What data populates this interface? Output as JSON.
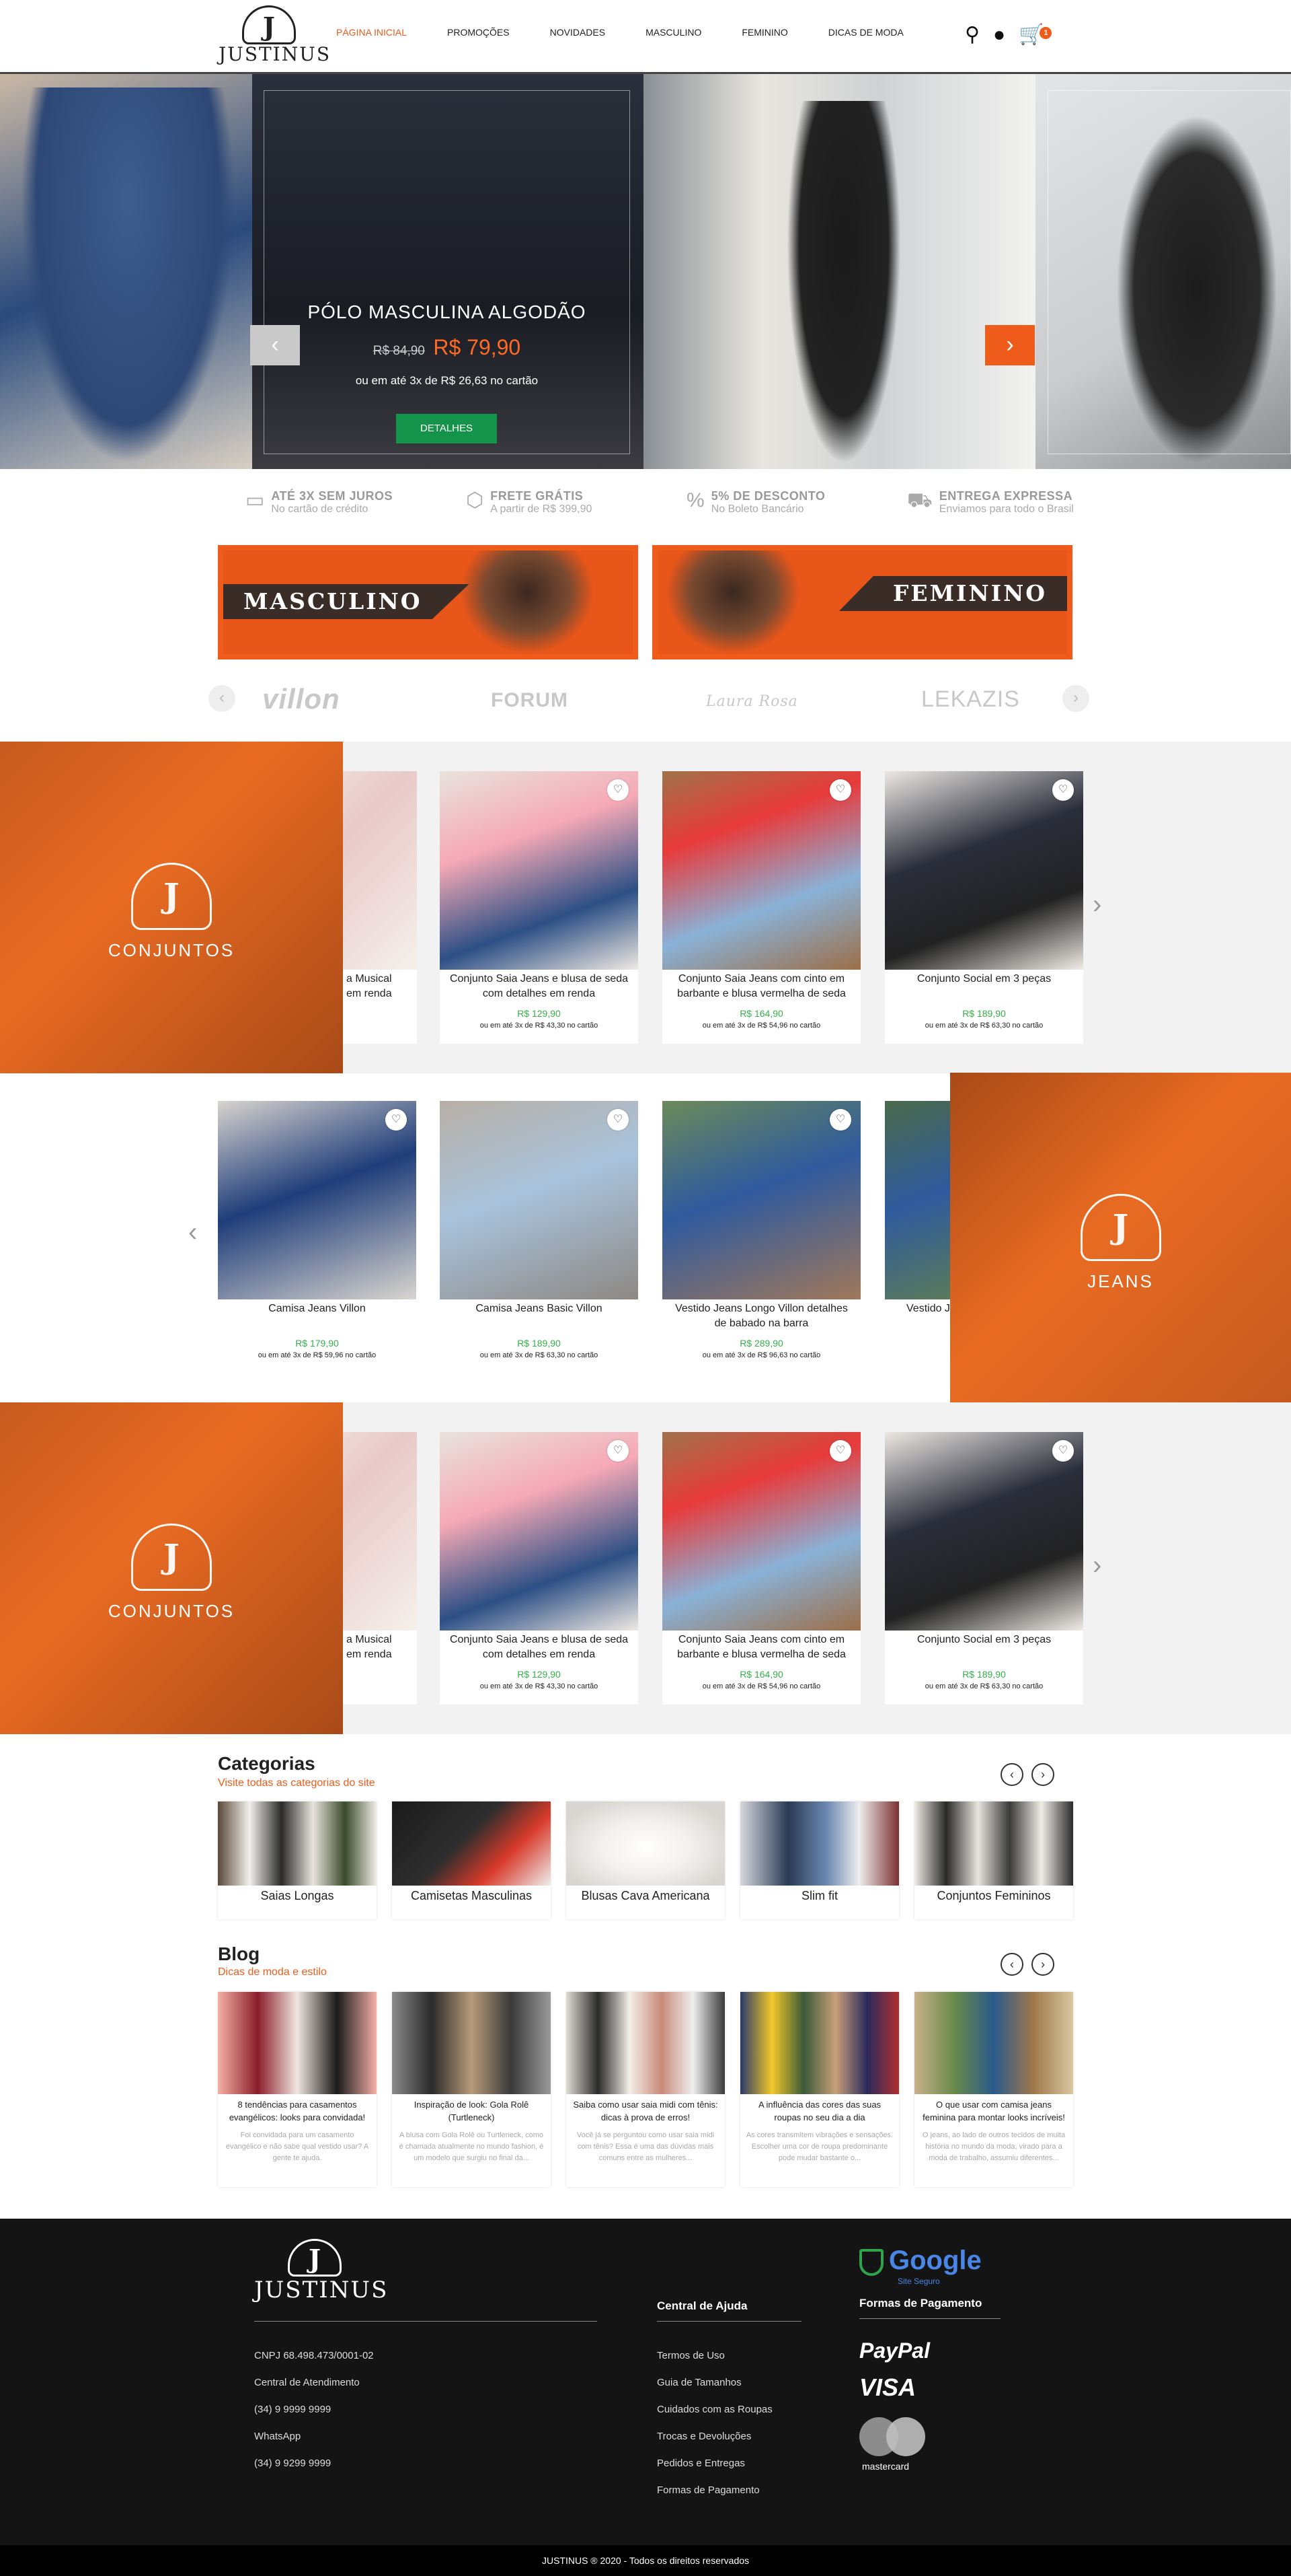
{
  "header": {
    "logo": "JUSTINUS",
    "nav": [
      "PÁGINA INICIAL",
      "PROMOÇÕES",
      "NOVIDADES",
      "MASCULINO",
      "FEMININO",
      "DICAS DE MODA"
    ],
    "cart_count": "1"
  },
  "hero": {
    "title": "PÓLO MASCULINA ALGODÃO",
    "old_price": "R$ 84,90",
    "new_price": "R$ 79,90",
    "installments": "ou em até 3x de R$ 26,63 no cartão",
    "button": "DETALHES",
    "prev": "‹",
    "next": "›"
  },
  "benefits": [
    {
      "icon": "credit-card-icon",
      "title": "ATÉ 3X SEM JUROS",
      "sub": "No cartão de crédito"
    },
    {
      "icon": "box-icon",
      "title": "FRETE GRÁTIS",
      "sub": "A partir de R$ 399,90"
    },
    {
      "icon": "percent-icon",
      "title": "5% DE DESCONTO",
      "sub": "No Boleto Bancário"
    },
    {
      "icon": "truck-icon",
      "title": "ENTREGA EXPRESSA",
      "sub": "Enviamos para todo o Brasil"
    }
  ],
  "category_banners": [
    "MASCULINO",
    "FEMININO"
  ],
  "brands": [
    "villon",
    "FORUM",
    "Laura Rosa",
    "LEKAZIS"
  ],
  "section1": {
    "label": "CONJUNTOS",
    "products": [
      {
        "name": "Conjunto Saia Jeans e blusa de seda com detalhes em renda",
        "price": "R$ 129,90",
        "inst": "ou em até 3x de R$ 43,30 no cartão"
      },
      {
        "name": "Conjunto Saia Jeans com cinto em barbante e blusa vermelha de seda",
        "price": "R$ 164,90",
        "inst": "ou em até 3x de R$ 54,96 no cartão"
      },
      {
        "name": "Conjunto Social em 3 peças",
        "price": "R$ 189,90",
        "inst": "ou em até 3x de R$ 63,30 no cartão"
      }
    ],
    "partial_name": "a Musical\nem renda"
  },
  "section2": {
    "label": "JEANS",
    "products": [
      {
        "name": "Camisa Jeans Villon",
        "price": "R$ 179,90",
        "inst": "ou em até 3x de R$ 59,96 no cartão"
      },
      {
        "name": "Camisa Jeans Basic Villon",
        "price": "R$ 189,90",
        "inst": "ou em até 3x de R$ 63,30 no cartão"
      },
      {
        "name": "Vestido Jeans Longo Villon detalhes de babado na barra",
        "price": "R$ 289,90",
        "inst": "ou em até 3x de R$ 96,63 no cartão"
      }
    ],
    "partial_name": "Vestido Je"
  },
  "section3": {
    "label": "CONJUNTOS",
    "products": [
      {
        "name": "Conjunto Saia Jeans e blusa de seda com detalhes em renda",
        "price": "R$ 129,90",
        "inst": "ou em até 3x de R$ 43,30 no cartão"
      },
      {
        "name": "Conjunto Saia Jeans com cinto em barbante e blusa vermelha de seda",
        "price": "R$ 164,90",
        "inst": "ou em até 3x de R$ 54,96 no cartão"
      },
      {
        "name": "Conjunto Social em 3 peças",
        "price": "R$ 189,90",
        "inst": "ou em até 3x de R$ 63,30 no cartão"
      }
    ],
    "partial_name": "a Musical\nem renda"
  },
  "categorias": {
    "title": "Categorias",
    "subtitle": "Visite todas as categorias do site",
    "items": [
      "Saias Longas",
      "Camisetas Masculinas",
      "Blusas Cava Americana",
      "Slim fit",
      "Conjuntos Femininos"
    ]
  },
  "blog": {
    "title": "Blog",
    "subtitle": "Dicas de moda e estilo",
    "posts": [
      {
        "title": "8 tendências para casamentos evangélicos: looks para convidada!",
        "excerpt": "Foi convidada para um casamento evangélico e não sabe qual vestido usar? A gente te ajuda."
      },
      {
        "title": "Inspiração de look: Gola Rolê (Turtleneck)",
        "excerpt": "A blusa com Gola Rolê ou Turtleneck, como é chamada atualmente no mundo fashion, é um modelo que surgiu no final da..."
      },
      {
        "title": "Saiba como usar saia midi com tênis: dicas à prova de erros!",
        "excerpt": "Você já se perguntou como usar saia midi com tênis? Essa é uma das dúvidas mais comuns entre as mulheres..."
      },
      {
        "title": "A influência das cores das suas roupas no seu dia a dia",
        "excerpt": "As cores transmitem vibrações e sensações. Escolher uma cor de roupa predominante pode mudar bastante o..."
      },
      {
        "title": "O que usar com camisa jeans feminina para montar looks incríveis!",
        "excerpt": "O jeans, ao lado de outros tecidos de muita história no mundo da moda, virado para a moda de trabalho, assumiu diferentes..."
      }
    ]
  },
  "footer": {
    "logo": "JUSTINUS",
    "info": [
      "CNPJ 68.498.473/0001-02",
      "Central de Atendimento",
      "(34) 9 9999 9999",
      "WhatsApp",
      "(34) 9 9299 9999"
    ],
    "help_title": "Central de Ajuda",
    "help": [
      "Termos de Uso",
      "Guia de Tamanhos",
      "Cuidados com as Roupas",
      "Trocas e Devoluções",
      "Pedidos e Entregas",
      "Formas de Pagamento"
    ],
    "google": "Google",
    "google_sub": "Site Seguro",
    "pay_title": "Formas de Pagamento",
    "paypal": "PayPal",
    "visa": "VISA",
    "mastercard": "mastercard",
    "copyright": "JUSTINUS ® 2020 - Todos os direitos reservados"
  },
  "colors": {
    "accent": "#ef5b1a",
    "green": "#14934a",
    "price_green": "#35b048",
    "footer": "#141414"
  }
}
